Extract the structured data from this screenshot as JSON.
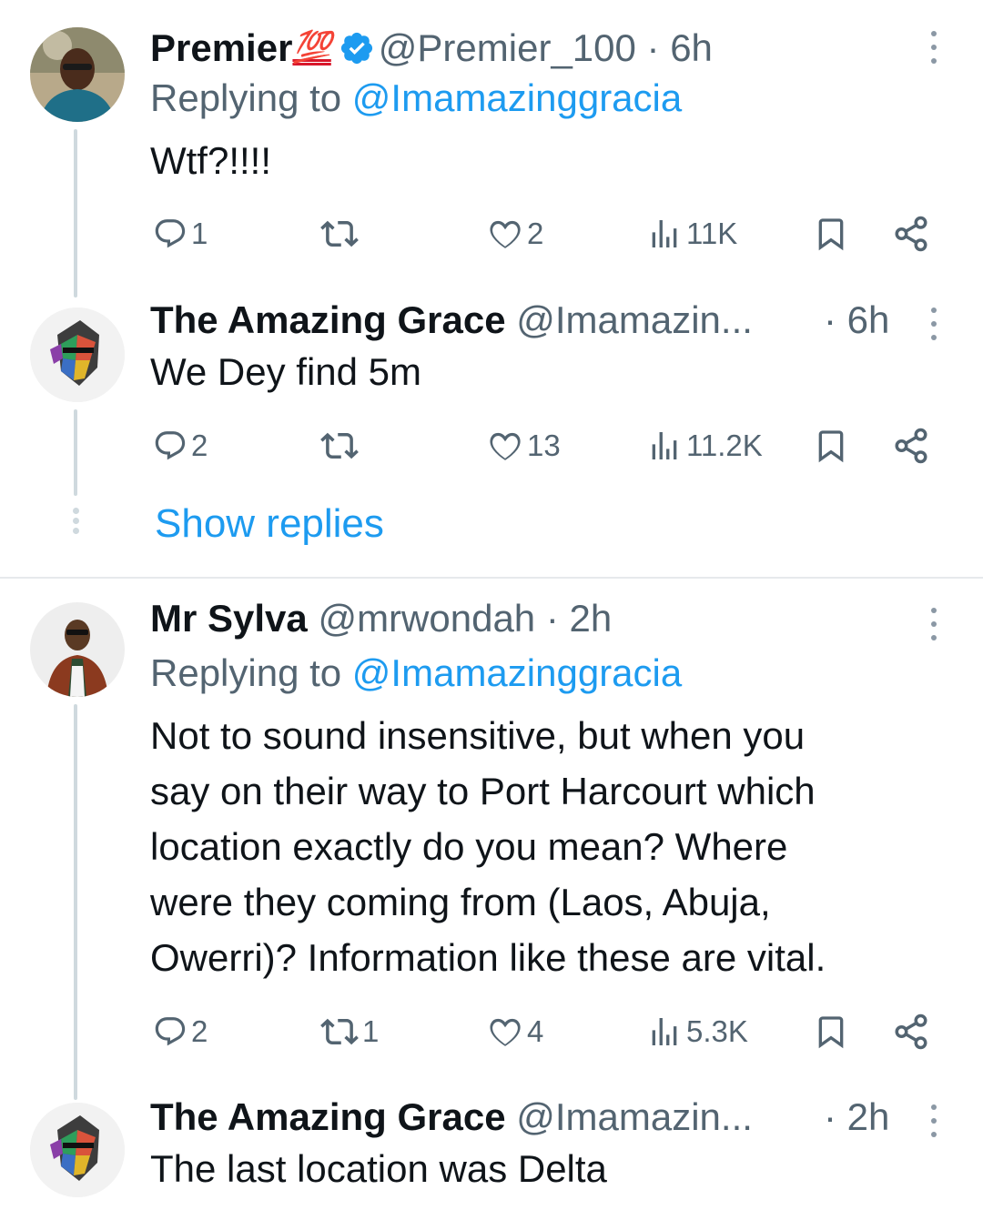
{
  "colors": {
    "link": "#1d9bf0",
    "secondary": "#536471",
    "text": "#0f1419",
    "verified": "#1d9bf0"
  },
  "tweets": [
    {
      "name": "Premier",
      "emoji": "💯",
      "verified": true,
      "handle": "@Premier_100",
      "time": "· 6h",
      "replying_prefix": "Replying to ",
      "replying_to": "@Imamazinggracia",
      "text": "Wtf?!!!!",
      "reply_count": "1",
      "retweet_count": "",
      "like_count": "2",
      "view_count": "11K"
    },
    {
      "name": "The Amazing Grace",
      "handle": "@Imamazin...",
      "time": "· 6h",
      "text": "We Dey find 5m",
      "reply_count": "2",
      "retweet_count": "",
      "like_count": "13",
      "view_count": "11.2K"
    },
    {
      "name": "Mr Sylva",
      "handle": "@mrwondah",
      "time": "· 2h",
      "replying_prefix": "Replying to ",
      "replying_to": "@Imamazinggracia",
      "text_lines": [
        "Not to sound insensitive,  but when you",
        "say on their way to Port Harcourt which",
        "location exactly do you mean? Where",
        "were they  coming from (Laos, Abuja,",
        "Owerri)? Information like these are vital."
      ],
      "reply_count": "2",
      "retweet_count": "1",
      "like_count": "4",
      "view_count": "5.3K"
    },
    {
      "name": "The Amazing Grace",
      "handle": "@Imamazin...",
      "time": "· 2h",
      "text": "The last location was Delta"
    }
  ],
  "show_replies_label": "Show replies",
  "icons": [
    "reply-icon",
    "retweet-icon",
    "like-icon",
    "views-icon",
    "bookmark-icon",
    "share-icon",
    "more-icon",
    "verified-badge-icon"
  ]
}
